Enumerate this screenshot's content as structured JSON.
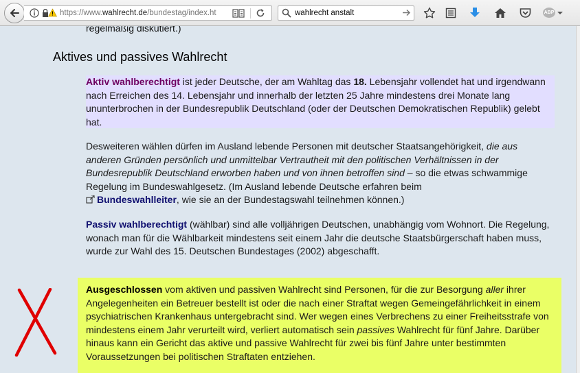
{
  "browser": {
    "url_prefix": "https://www.",
    "url_domain": "wahlrecht.de",
    "url_path": "/bundestag/index.ht",
    "search_query": "wahlrecht anstalt",
    "abp_label": "ABP"
  },
  "page": {
    "prev_line": "regelmäßig diskutiert.)",
    "heading": "Aktives und passives Wahlrecht",
    "aktiv": {
      "term": "Aktiv wahlberechtigt",
      "t1": " ist jeder Deutsche, der am Wahltag das ",
      "age": "18.",
      "t2": " Lebensjahr vollendet hat und irgendwann nach Erreichen des 14. Lebensjahr und innerhalb der letzten 25 Jahre mindestens drei Monate lang ununterbrochen in der Bundesrepublik Deutschland (oder der Deutschen Demokratischen Republik) gelebt hat."
    },
    "ausland": {
      "t1": "Desweiteren wählen dürfen im Ausland lebende Personen mit deutscher Staatsangehörigkeit, ",
      "t2": "die aus anderen Gründen persönlich und unmittelbar Vertrautheit mit den politischen Verhältnissen in der Bundesrepublik Deutschland erworben haben und von ihnen betroffen sind",
      "t3": " – so die etwas schwammige Regelung im Bundeswahlgesetz. (Im Ausland lebende Deutsche erfahren beim ",
      "link": "Bundeswahlleiter",
      "t4": ", wie sie an der Bundestagswahl teilnehmen können.)"
    },
    "passiv": {
      "term": "Passiv wahlberechtigt",
      "t1": " (wählbar) sind alle volljährigen Deutschen, unabhängig vom Wohnort. Die Regelung, wonach man für die Wählbarkeit mindestens seit einem Jahr die deutsche Staatsbürgerschaft haben muss, wurde zur Wahl des 15. Deutschen Bundestages (2002) abgeschafft."
    },
    "ausgeschlossen": {
      "term": "Ausgeschlossen",
      "t1": " vom aktiven und passiven Wahlrecht sind Personen, für die zur Besorgung ",
      "i1": "aller",
      "t2": " ihrer Angelegenheiten ein Betreuer bestellt ist oder die nach einer Straftat wegen Gemeingefährlichkeit in einem psychiatrischen Krankenhaus untergebracht sind. Wer wegen eines Verbrechens zu einer Freiheitsstrafe von mindestens einem Jahr verurteilt wird, verliert automatisch sein ",
      "i2": "passives",
      "t3": " Wahlrecht für fünf Jahre. Darüber hinaus kann ein Gericht das aktive und passive Wahlrecht für zwei bis fünf Jahre unter bestimmten Voraussetzungen bei politischen Straftaten entziehen."
    }
  },
  "colors": {
    "aktiv_bg": "#e2deff",
    "ausgeschlossen_bg": "#eaff66",
    "term_purple": "#6e0060",
    "term_navy": "#101070",
    "annotation_red": "#e00000"
  }
}
